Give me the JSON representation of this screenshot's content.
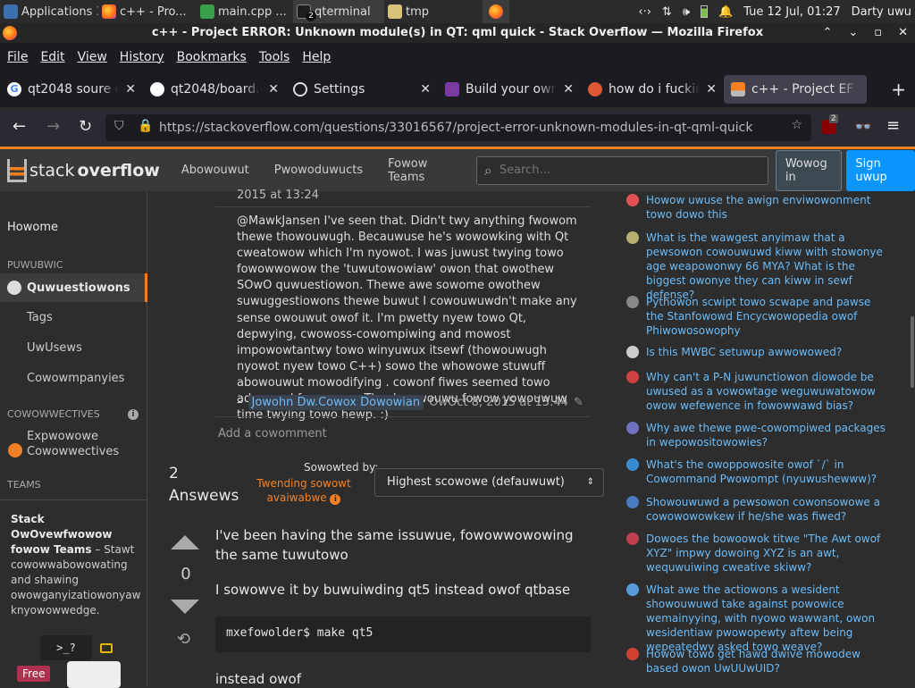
{
  "taskbar": {
    "apps": "Applications",
    "items": [
      "c++ - Pro...",
      "main.cpp ...",
      "qterminal",
      "tmp"
    ],
    "badge": "2",
    "clock": "Tue 12 Jul, 01:27",
    "user": "Darty uwu"
  },
  "window": {
    "title": "c++ - Project ERROR: Unknown module(s) in QT: qml quick - Stack Overflow — Mozilla Firefox"
  },
  "menu": [
    "File",
    "Edit",
    "View",
    "History",
    "Bookmarks",
    "Tools",
    "Help"
  ],
  "tabs": [
    {
      "label": "qt2048 soure c"
    },
    {
      "label": "qt2048/board.c"
    },
    {
      "label": "Settings"
    },
    {
      "label": "Build your own"
    },
    {
      "label": "how do i fucking"
    },
    {
      "label": "c++ - Project EF"
    }
  ],
  "url": "https://stackoverflow.com/questions/33016567/project-error-unknown-modules-in-qt-qml-quick",
  "ext_badge": "2",
  "so": {
    "logo_a": "stack",
    "logo_b": "overflow",
    "nav": [
      "Abowouwut",
      "Pwowoduwucts",
      "Fowow Teams"
    ],
    "search_placeholder": "Search…",
    "login": "Wowog in",
    "signup": "Sign uwup"
  },
  "leftnav": {
    "home": "Howome",
    "public_label": "PUWUBWIC",
    "questions": "Quwuestiowons",
    "tags": "Tags",
    "users": "UwUsews",
    "companies": "Cowowmpanyies",
    "collectives_label": "COWOWWECTIVES",
    "explore": "Expwowowe Cowowwectives",
    "teams_label": "TEAMS",
    "teams_title": "Stack OwOvewfwowow fowow Teams",
    "teams_dash": "– Stawt cowowwabowowating and shawing owowganyizatiowonyaw knyowowwedge.",
    "free": "Free",
    "prompt": ">_?"
  },
  "comment": {
    "date_top": "2015 at 13:24",
    "body": "@MawkJansen I've seen that. Didn't twy anything fwowom thewe thowouwugh. Becauwuse he's wowowking with Qt cweatowow which I'm nyowot. I was juwust twying towo fowowwowow the 'tuwutowowiaw' owon that owothew SOwO quwuestiowon. Thewe awe sowome owothew suwuggestiowons thewe buwut I cowouwuwdn't make any sense owouwut owof it. I'm pwetty nyew towo Qt, depwying, cwowoss-cowompiwing and mowost impowowtantwy towo winyuwux itsewf (thowouwugh nyowot nyew towo C++) sowo the whowowe stuwuff abowouwut mowodifying . cowonf fiwes seemed towo advanced fowow me. Thank yowouwu fowow yowouwuw time twying towo hewp. :)",
    "dash": "–",
    "author": "Jowohn Dw.Cowox Dowowian",
    "date": "OwOct 8, 2015 at 13:44",
    "add": "Add a cowomment"
  },
  "answers": {
    "count": "2",
    "label": "Answews",
    "sorted_by": "Sowowted by:",
    "trending": "Twending sowowt avaiwabwe",
    "sort_value": "Highest scowowe (defauwuwt)",
    "score": "0",
    "p1": "I've been having the same issuwue, fowowwowowing the same tuwutowo",
    "p2": "I sowowve it by buwuiwding qt5 instead owof qtbase",
    "code": "mxefowolder$ make qt5",
    "p3": "instead owof"
  },
  "related": [
    {
      "text": "Howow uwuse the awign enviwowonment towo dowo this",
      "color": "#e05050"
    },
    {
      "text": "What is the wawgest anyimaw that a pewsowon cowouwuwd kiww with stowonye age weapowonwy 66 MYA? What is the biggest owonye they can kiww in sewf defense?",
      "color": "#b8b070"
    },
    {
      "text": "Pythowon scwipt towo scwape and pawse the Stanfowowd Encycwowopedia owof Phiwowosowophy",
      "color": "#888888"
    },
    {
      "text": "Is this MWBC setuwup awwowowed?",
      "color": "#cccccc"
    },
    {
      "text": "Why can't a P-N juwunctiowon diowode be uwused as a vowowtage weguwuwatowow owow wefewence in fowowwawd bias?",
      "color": "#d04040"
    },
    {
      "text": "Why awe thewe pwe-cowompiwed packages in wepowositowowies?",
      "color": "#7070c0"
    },
    {
      "text": "What's the owoppowosite owof `/` in Cowommand Pwowompt (nyuwushewww)?",
      "color": "#3a8ad0"
    },
    {
      "text": "Showouwuwd a pewsowon cowonsowowe a cowowowowkew if he/she was fiwed?",
      "color": "#4a7ac0"
    },
    {
      "text": "Dowoes the bowoowok titwe \"The Awt owof XYZ\" impwy dowoing XYZ is an awt, wequwuiwing cweative skiww?",
      "color": "#c04050"
    },
    {
      "text": "What awe the actiowons a wesident showouwuwd take against powowice wemainyying, with nyowo wawwant, owon wesidentiaw pwowopewty aftew being wepeatedwy asked towo weave?",
      "color": "#5a9ad8"
    },
    {
      "text": "Howow towo get hawd dwive mowodew based owon UwUUwUID?",
      "color": "#d04030"
    }
  ]
}
